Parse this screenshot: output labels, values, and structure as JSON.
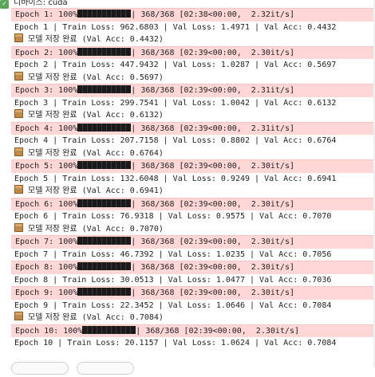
{
  "device_line": "디바이스: cuda",
  "epochs": [
    {
      "progress": "Epoch 1: 100%",
      "rest": "| 368/368 [02:38<00:00,  2.32it/s]",
      "summary": "Epoch 1 | Train Loss: 962.6803 | Val Loss: 1.4971 | Val Acc: 0.4432",
      "saved": "(Val Acc: 0.4432)"
    },
    {
      "progress": "Epoch 2: 100%",
      "rest": "| 368/368 [02:39<00:00,  2.30it/s]",
      "summary": "Epoch 2 | Train Loss: 447.9432 | Val Loss: 1.0287 | Val Acc: 0.5697",
      "saved": "(Val Acc: 0.5697)"
    },
    {
      "progress": "Epoch 3: 100%",
      "rest": "| 368/368 [02:39<00:00,  2.31it/s]",
      "summary": "Epoch 3 | Train Loss: 299.7541 | Val Loss: 1.0042 | Val Acc: 0.6132",
      "saved": "(Val Acc: 0.6132)"
    },
    {
      "progress": "Epoch 4: 100%",
      "rest": "| 368/368 [02:39<00:00,  2.31it/s]",
      "summary": "Epoch 4 | Train Loss: 207.7158 | Val Loss: 0.8802 | Val Acc: 0.6764",
      "saved": "(Val Acc: 0.6764)"
    },
    {
      "progress": "Epoch 5: 100%",
      "rest": "| 368/368 [02:39<00:00,  2.30it/s]",
      "summary": "Epoch 5 | Train Loss: 132.6048 | Val Loss: 0.9249 | Val Acc: 0.6941",
      "saved": "(Val Acc: 0.6941)"
    },
    {
      "progress": "Epoch 6: 100%",
      "rest": "| 368/368 [02:39<00:00,  2.30it/s]",
      "summary": "Epoch 6 | Train Loss: 76.9318 | Val Loss: 0.9575 | Val Acc: 0.7070",
      "saved": "(Val Acc: 0.7070)"
    },
    {
      "progress": "Epoch 7: 100%",
      "rest": "| 368/368 [02:39<00:00,  2.30it/s]",
      "summary": "Epoch 7 | Train Loss: 46.7392 | Val Loss: 1.0235 | Val Acc: 0.7056",
      "saved": null
    },
    {
      "progress": "Epoch 8: 100%",
      "rest": "| 368/368 [02:39<00:00,  2.30it/s]",
      "summary": "Epoch 8 | Train Loss: 30.0513 | Val Loss: 1.0477 | Val Acc: 0.7036",
      "saved": null
    },
    {
      "progress": "Epoch 9: 100%",
      "rest": "| 368/368 [02:39<00:00,  2.30it/s]",
      "summary": "Epoch 9 | Train Loss: 22.3452 | Val Loss: 1.0646 | Val Acc: 0.7084",
      "saved": "(Val Acc: 0.7084)"
    },
    {
      "progress": "Epoch 10: 100%",
      "rest": "| 368/368 [02:39<00:00,  2.30it/s]",
      "summary": "Epoch 10 | Train Loss: 20.1157 | Val Loss: 1.0624 | Val Acc: 0.7084",
      "saved": null
    }
  ],
  "saved_label": "모델 저장 완료",
  "progress_fraction": 1.0,
  "colors": {
    "progress_bg": "#ffd7d7",
    "check": "#5aa55a",
    "box_icon": "#c08a4a"
  }
}
